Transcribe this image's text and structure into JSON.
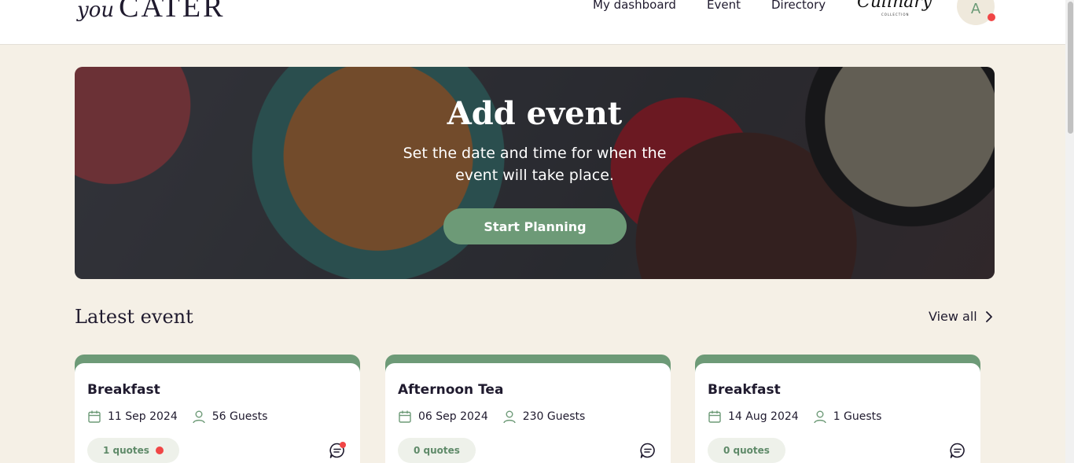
{
  "header": {
    "logo_you": "you",
    "logo_cater": "CATER",
    "nav": [
      "My dashboard",
      "Event",
      "Directory"
    ],
    "partner_logo": "Culinary",
    "partner_sub": "COLLECTION",
    "avatar_initial": "A"
  },
  "hero": {
    "title": "Add event",
    "subtitle": "Set the date and time for when the event will take place.",
    "button": "Start Planning"
  },
  "latest": {
    "title": "Latest event",
    "view_all": "View all"
  },
  "events": [
    {
      "title": "Breakfast",
      "date": "11 Sep 2024",
      "guests": "56 Guests",
      "quotes": "1 quotes",
      "unread": true
    },
    {
      "title": "Afternoon Tea",
      "date": "06 Sep 2024",
      "guests": "230 Guests",
      "quotes": "0 quotes",
      "unread": false
    },
    {
      "title": "Breakfast",
      "date": "14 Aug 2024",
      "guests": "1 Guests",
      "quotes": "0 quotes",
      "unread": false
    }
  ],
  "colors": {
    "accent": "#6d9a77",
    "background": "#f5f0e6",
    "notification": "#f04646"
  },
  "icons": [
    "calendar-icon",
    "user-icon",
    "chat-icon",
    "chevron-right-icon"
  ]
}
